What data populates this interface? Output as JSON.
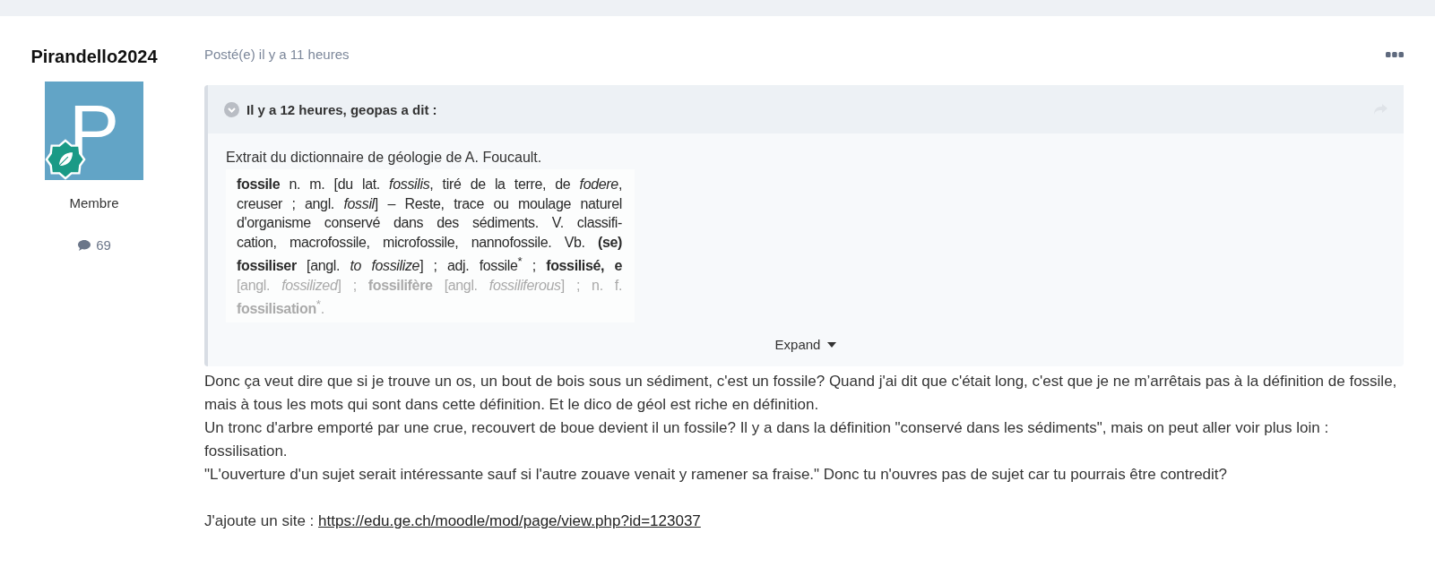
{
  "author": {
    "name": "Pirandello2024",
    "avatar_letter": "P",
    "role": "Membre",
    "post_count": "69"
  },
  "post": {
    "meta": "Posté(e) il y a 11 heures",
    "quote": {
      "citation": "Il y a 12 heures, geopas a dit :",
      "intro": "Extrait du dictionnaire de géologie de A. Foucault.",
      "excerpt_lines": [
        {
          "text": "**fossile** n. m. [du lat. *fossilis*, tiré de la terre, de *fodere*,",
          "faded": false
        },
        {
          "text": "creuser ; angl. *fossil*] – Reste, trace ou moulage naturel",
          "faded": false
        },
        {
          "text": "d'organisme conservé dans des sédiments. V. classifi-",
          "faded": false
        },
        {
          "text": "cation, macrofossile, microfossile, nannofossile. Vb. **(se)**",
          "faded": false
        },
        {
          "text": "**fossiliser** [angl. *to fossilize*] ; adj. fossile$^{*}$ ; **fossilisé, e**",
          "faded": false
        },
        {
          "text": "[angl. *fossilized*] ; **fossilifère** [angl. *fossiliferous*] ; n. f.",
          "faded": true
        },
        {
          "text": "**fossilisation**$^{*}$.",
          "faded": true
        }
      ],
      "expand": "Expand"
    },
    "paragraphs": [
      "Donc ça veut dire que si je trouve un os, un bout de bois sous un sédiment, c'est un fossile? Quand j'ai dit que c'était long, c'est que je ne m’arrêtais pas à la définition de fossile, mais à tous les mots qui sont dans cette définition. Et le dico de géol est riche en définition.",
      "Un tronc d'arbre emporté par une crue, recouvert de boue devient il un fossile? Il y a dans la définition \"conservé dans les sédiments\", mais on peut aller voir plus loin : fossilisation.",
      "\"L'ouverture d'un sujet serait intéressante sauf si l'autre zouave venait y ramener sa fraise.\" Donc tu n'ouvres pas de sujet car tu pourrais être contredit?"
    ],
    "link_line": {
      "text": "J'ajoute un site :",
      "url": "https://edu.ge.ch/moodle/mod/page/view.php?id=123037"
    }
  }
}
